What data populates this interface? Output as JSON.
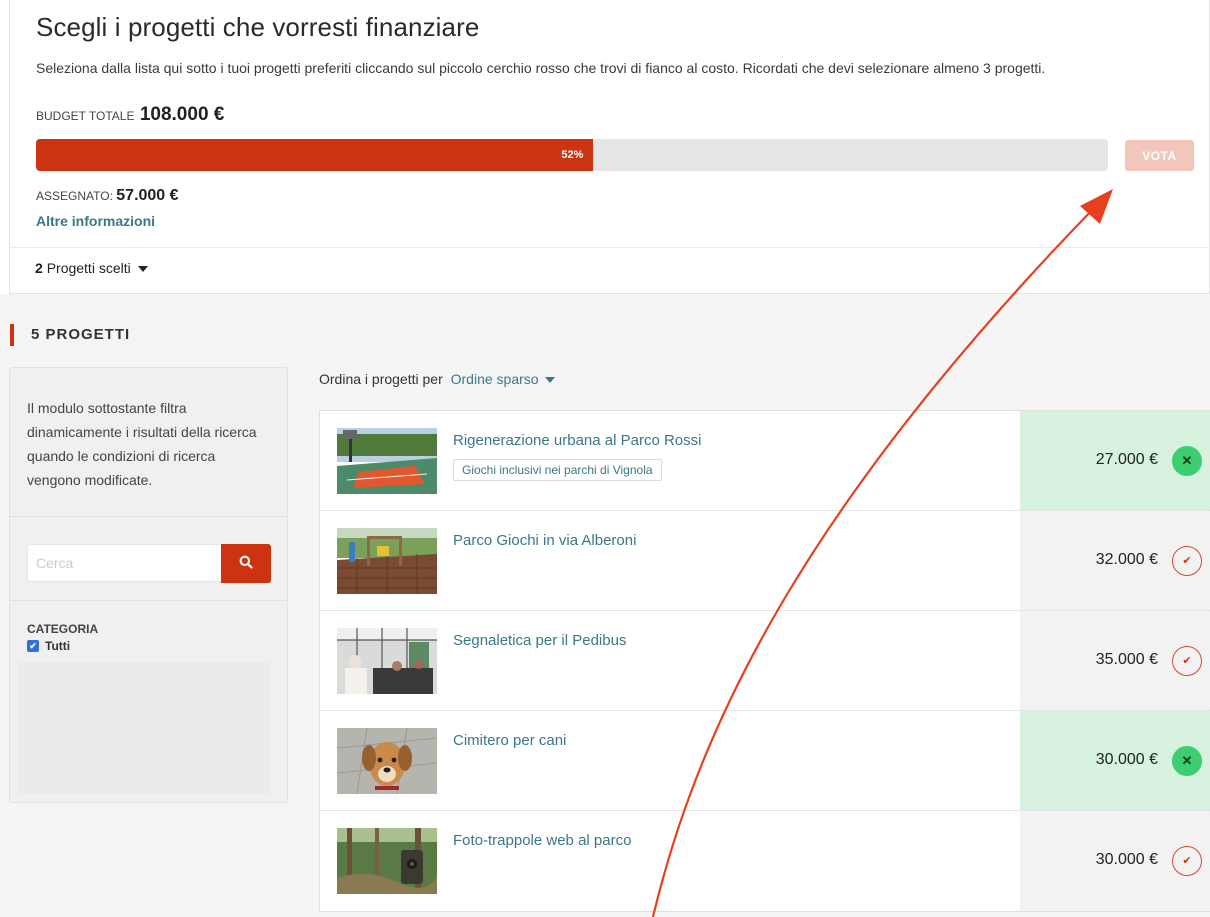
{
  "header": {
    "title": "Scegli i progetti che vorresti finanziare",
    "description": "Seleziona dalla lista qui sotto i tuoi progetti preferiti cliccando sul piccolo cerchio rosso che trovi di fianco al costo. Ricordati che devi selezionare almeno 3 progetti.",
    "budget_label": "Budget totale",
    "budget_value": "108.000 €",
    "progress_percent": 52,
    "progress_label": "52%",
    "vote_label": "VOTA",
    "assigned_label": "Assegnato:",
    "assigned_value": "57.000 €",
    "more_info": "Altre informazioni",
    "chosen_count": "2",
    "chosen_label": "Progetti scelti"
  },
  "section": {
    "title": "5 PROGETTI"
  },
  "filters": {
    "description": "Il modulo sottostante filtra dinamicamente i risultati della ricerca quando le condizioni di ricerca vengono modificate.",
    "search_placeholder": "Cerca",
    "search_icon": "search-icon",
    "category_label": "Categoria",
    "category_all": "Tutti",
    "category_all_checked": true
  },
  "sort": {
    "label": "Ordina i progetti per",
    "value": "Ordine sparso"
  },
  "projects": [
    {
      "title": "Rigenerazione urbana al Parco Rossi",
      "tag": "Giochi inclusivi nei parchi di Vignola",
      "cost": "27.000 €",
      "selected": true
    },
    {
      "title": "Parco Giochi in via Alberoni",
      "tag": "",
      "cost": "32.000 €",
      "selected": false
    },
    {
      "title": "Segnaletica per il Pedibus",
      "tag": "",
      "cost": "35.000 €",
      "selected": false
    },
    {
      "title": "Cimitero per cani",
      "tag": "",
      "cost": "30.000 €",
      "selected": true
    },
    {
      "title": "Foto-trappole web al parco",
      "tag": "",
      "cost": "30.000 €",
      "selected": false
    }
  ],
  "colors": {
    "accent": "#cc3311",
    "link": "#3b7886",
    "selected_bg": "#d7f3df",
    "selected_btn": "#3dce72",
    "annotation_arrow": "#e8401f"
  }
}
